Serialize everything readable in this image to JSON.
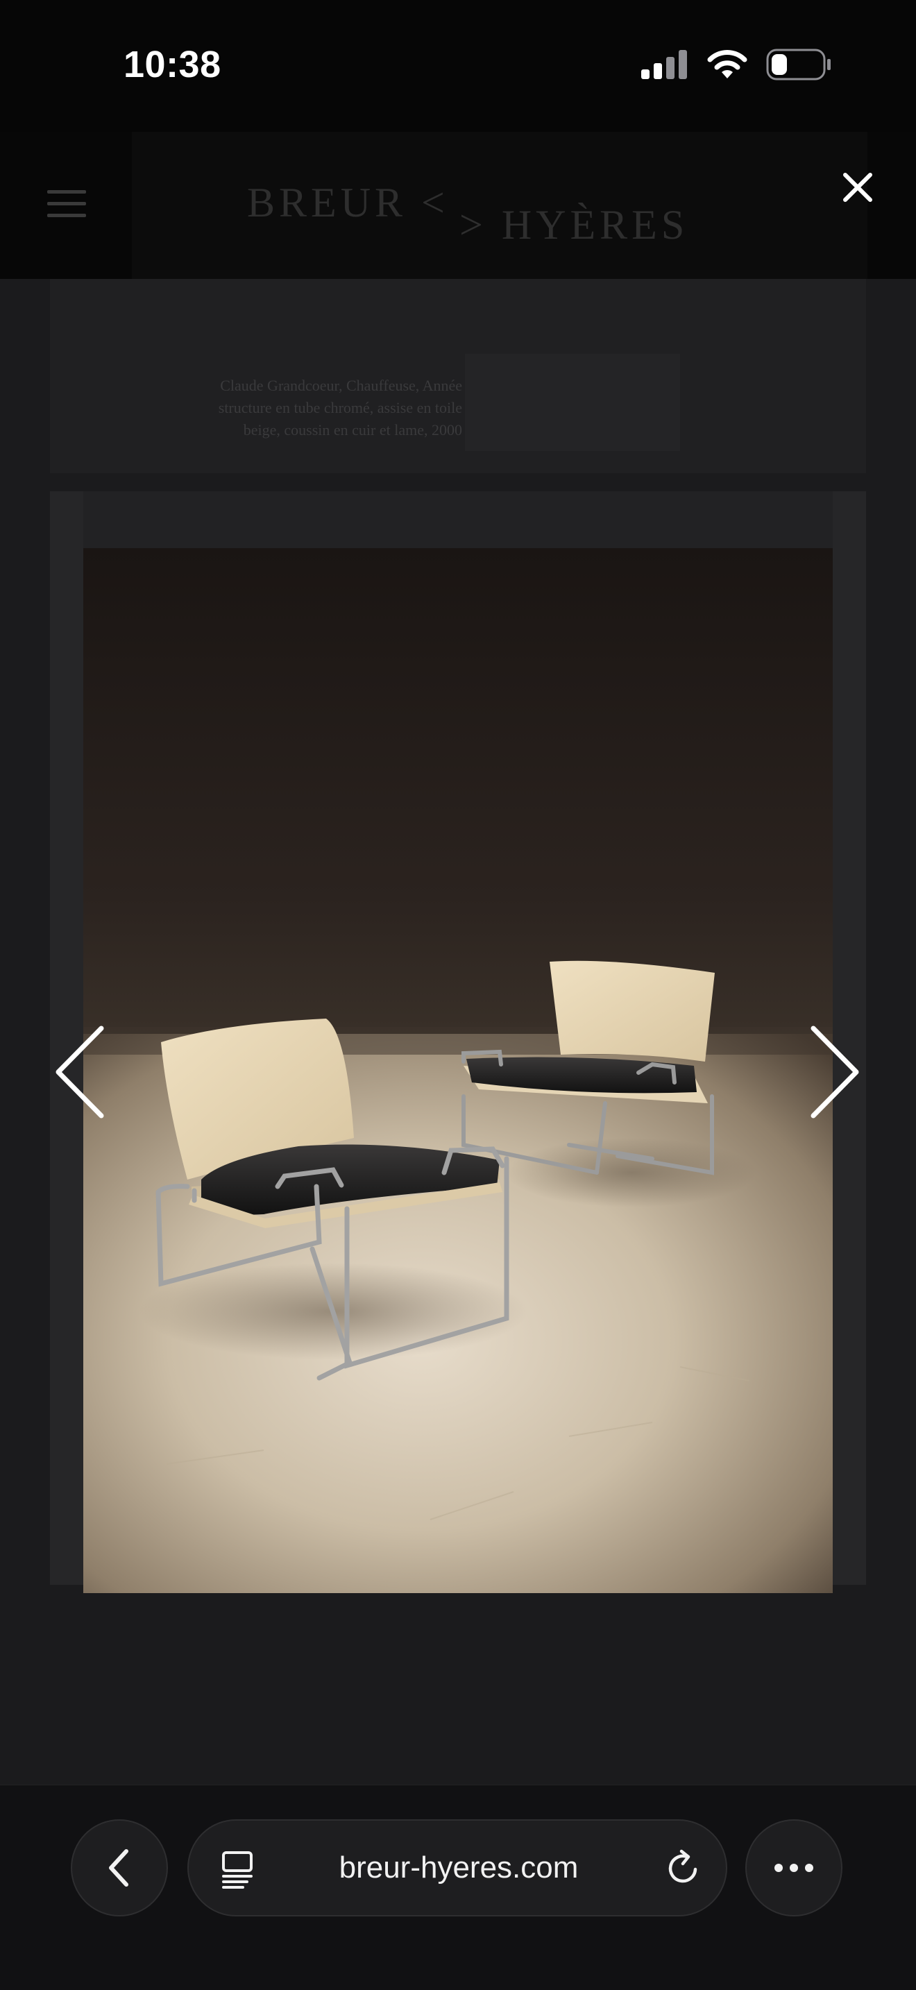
{
  "status_bar": {
    "time": "10:38",
    "icons": [
      "cellular-signal-icon",
      "wifi-icon",
      "battery-icon"
    ]
  },
  "site": {
    "logo_left": "BREUR <",
    "logo_right": "> HYÈRES",
    "caption_lines": [
      "Claude Grandcoeur, Chauffeuse, Année",
      "structure en tube chromé, assise en toile",
      "beige, coussin en cuir et lame, 2000"
    ]
  },
  "lightbox": {
    "image_alt": "Pair of lounge chairs with chromed tubular frames, beige backs and black leather cushions on a concrete floor",
    "close_icon": "close-icon",
    "prev_icon": "chevron-left-icon",
    "next_icon": "chevron-right-icon"
  },
  "browser": {
    "url": "breur-hyeres.com",
    "icons": [
      "back-icon",
      "tabs-icon",
      "reload-icon",
      "more-icon"
    ]
  },
  "colors": {
    "status_bg": "#060606",
    "page_bg": "#1b1b1d",
    "browser_bg": "#111113",
    "text": "#ffffff"
  }
}
